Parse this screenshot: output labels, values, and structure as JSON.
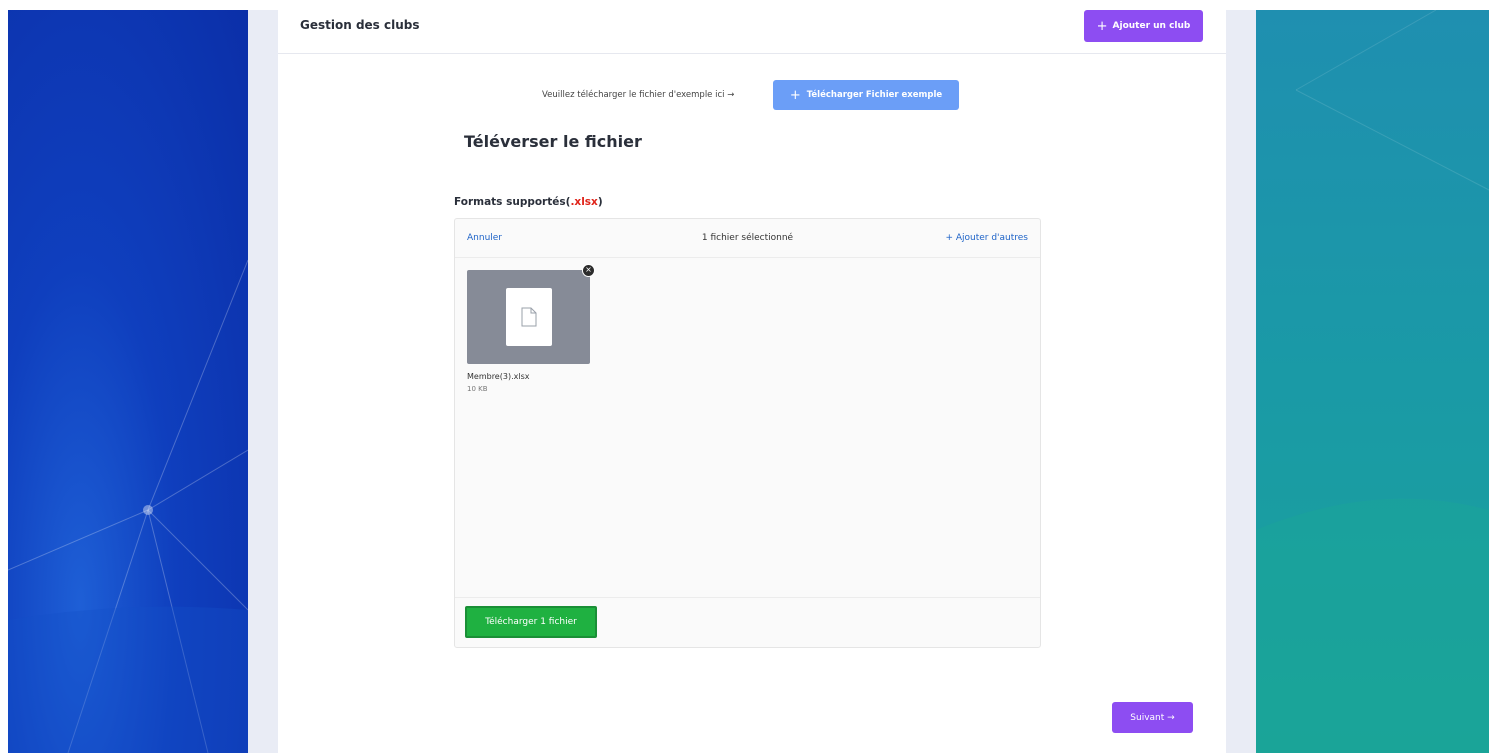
{
  "header": {
    "title": "Gestion des clubs",
    "add_club": {
      "icon": "plus-icon",
      "label": "Ajouter un club"
    }
  },
  "sample": {
    "text": "Veuillez télécharger le fichier d'exemple ici →",
    "button_label": "Télécharger Fichier exemple",
    "button_icon": "plus-icon"
  },
  "upload_title": "Téléverser le fichier",
  "formats": {
    "prefix": "Formats supportés(",
    "extension": ".xlsx",
    "suffix": ")"
  },
  "uploader": {
    "cancel": "Annuler",
    "selected_count": "1 fichier sélectionné",
    "add_more": "+ Ajouter d'autres",
    "files": [
      {
        "name": "Membre(3).xlsx",
        "size": "10 KB",
        "icon": "file-icon"
      }
    ],
    "upload_button": "Télécharger 1 fichier"
  },
  "next_button": "Suivant →",
  "colors": {
    "accent_purple": "#8d4df2",
    "sample_blue": "#6b9ef7",
    "upload_green": "#1fb141",
    "format_red": "#e0241a",
    "link_blue": "#1f64c8"
  }
}
